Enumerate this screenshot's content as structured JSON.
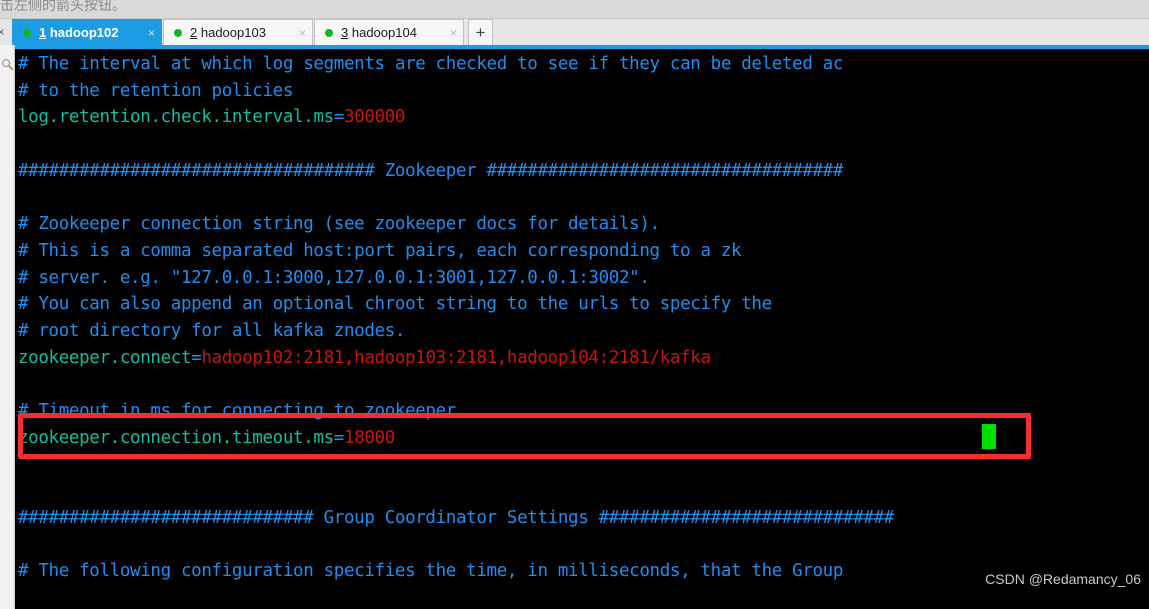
{
  "hint": {
    "text": "击左侧的箭头按钮。"
  },
  "tabbar": {
    "scroll_left_icon": "×",
    "add_tab_label": "+",
    "tabs": [
      {
        "index": "1",
        "name": "hadoop102",
        "close_icon": "×",
        "status_dot_color": "#10b520",
        "active": true
      },
      {
        "index": "2",
        "name": "hadoop103",
        "close_icon": "×",
        "status_dot_color": "#10b520",
        "active": false
      },
      {
        "index": "3",
        "name": "hadoop104",
        "close_icon": "×",
        "status_dot_color": "#10b520",
        "active": false
      }
    ]
  },
  "siderail": {
    "search_icon": "search-icon"
  },
  "terminal": {
    "background": "#000000",
    "title_accent": "#1e9ce3",
    "comment_color": "#1f8ef1",
    "key_color": "#0fbfa0",
    "value_color": "#cc1111",
    "cursor_color": "#00e000",
    "lines": [
      {
        "type": "comment",
        "text": "# The interval at which log segments are checked to see if they can be deleted ac"
      },
      {
        "type": "comment",
        "text": "# to the retention policies"
      },
      {
        "type": "config",
        "key": "log.retention.check.interval.ms",
        "value": "300000"
      },
      {
        "type": "blank",
        "text": ""
      },
      {
        "type": "comment",
        "text": "################################### Zookeeper ###################################"
      },
      {
        "type": "blank",
        "text": ""
      },
      {
        "type": "comment",
        "text": "# Zookeeper connection string (see zookeeper docs for details)."
      },
      {
        "type": "comment",
        "text": "# This is a comma separated host:port pairs, each corresponding to a zk"
      },
      {
        "type": "comment",
        "text": "# server. e.g. \"127.0.0.1:3000,127.0.0.1:3001,127.0.0.1:3002\"."
      },
      {
        "type": "comment",
        "text": "# You can also append an optional chroot string to the urls to specify the"
      },
      {
        "type": "comment",
        "text": "# root directory for all kafka znodes."
      },
      {
        "type": "config",
        "key": "zookeeper.connect",
        "value": "hadoop102:2181,hadoop103:2181,hadoop104:2181/kafka"
      },
      {
        "type": "blank",
        "text": ""
      },
      {
        "type": "comment",
        "text": "# Timeout in ms for connecting to zookeeper"
      },
      {
        "type": "config",
        "key": "zookeeper.connection.timeout.ms",
        "value": "18000"
      },
      {
        "type": "blank",
        "text": ""
      },
      {
        "type": "blank",
        "text": ""
      },
      {
        "type": "comment",
        "text": "############################# Group Coordinator Settings #############################"
      },
      {
        "type": "blank",
        "text": ""
      },
      {
        "type": "comment",
        "text": "# The following configuration specifies the time, in milliseconds, that the Group"
      }
    ]
  },
  "annotation": {
    "color": "#fb2c2c",
    "target_line": "zookeeper.connect=hadoop102:2181,hadoop103:2181,hadoop104:2181/kafka"
  },
  "watermark": {
    "text": "CSDN @Redamancy_06"
  }
}
